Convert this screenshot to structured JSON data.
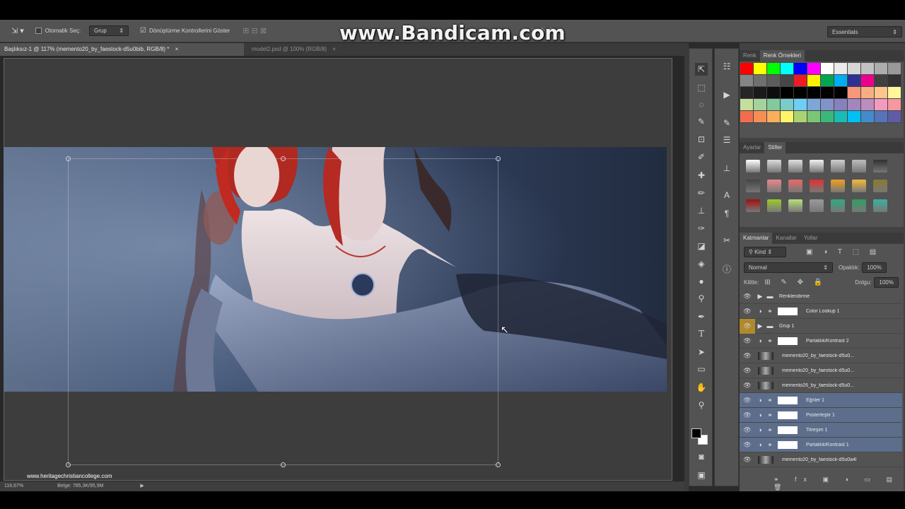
{
  "watermark": "www.Bandicam.com",
  "options_bar": {
    "auto_select_label": "Otomatik Seç:",
    "auto_select_value": "Grup",
    "transform_controls_label": "Dönüştürme Kontrollerini Göster",
    "workspace": "Essentials"
  },
  "document_tabs": [
    {
      "label": "Başlıksız-1 @ 117% (memento20_by_faestock-d5u0bib, RGB/8) *",
      "close": "×"
    },
    {
      "label": "model2.psd @ 100% (RGB/8)",
      "close": "×"
    }
  ],
  "status_bar": {
    "zoom": "116,67%",
    "doc": "Belge: 785,3K/95,9M"
  },
  "site_watermark": "www.heritagechristiancollege.com",
  "color_panel": {
    "tabs": [
      "Renk",
      "Renk Örnekleri"
    ],
    "active": "Renk Örnekleri",
    "row1": [
      "#ff0000",
      "#ffff00",
      "#00ff00",
      "#00ffff",
      "#0000ff",
      "#ff00ff",
      "#ffffff",
      "#ebebeb",
      "#d6d6d6",
      "#c2c2c2",
      "#adadad",
      "#999999"
    ],
    "row2": [
      "#858585",
      "#707070",
      "#5c5c5c",
      "#474747",
      "#ed1c24",
      "#fff200",
      "#00a651",
      "#00aeef",
      "#2e3192",
      "#ec008c",
      "#404040",
      "#333333"
    ],
    "row3": [
      "#262626",
      "#1a1a1a",
      "#0d0d0d",
      "#000000",
      "#000000",
      "#000000",
      "#000000",
      "#000000",
      "#f7977a",
      "#fbad82",
      "#fdc68c",
      "#fff799"
    ],
    "row4": [
      "#c4df9b",
      "#a3d39c",
      "#82ca9c",
      "#7accc8",
      "#6dcff6",
      "#7da7d9",
      "#8393ca",
      "#8781bd",
      "#a187be",
      "#bc8dbf",
      "#f49ac1",
      "#f6989d"
    ],
    "row5": [
      "#f26c4f",
      "#f68e56",
      "#fbaf5d",
      "#fff568",
      "#acd372",
      "#7cc576",
      "#3bb878",
      "#1abbb4",
      "#00bff3",
      "#438ccb",
      "#5574b9",
      "#605ca8"
    ]
  },
  "styles_panel": {
    "tabs": [
      "Ayarlar",
      "Stiller"
    ],
    "active": "Stiller",
    "row1": [
      "#ffffff",
      "#dcdcdc",
      "#e0e0e0",
      "#f2f2f2",
      "#cfcfcf",
      "#bdbdbd",
      "#303030"
    ],
    "row2": [
      "#444444",
      "#e9888b",
      "#e86a6a",
      "#e03030",
      "#f0a020",
      "#f5b83a",
      "#8a7a2e"
    ],
    "row3": [
      "#a01010",
      "#9bcc2a",
      "#b8e07a",
      "#9a9a9a",
      "#2faa80",
      "#2ea060",
      "#3ab0a0"
    ]
  },
  "layers_panel": {
    "tabs": [
      "Katmanlar",
      "Kanallar",
      "Yollar"
    ],
    "active": "Katmanlar",
    "filter": "Kind",
    "blend_mode": "Normal",
    "opacity_label": "Opaklık:",
    "opacity_value": "100%",
    "lock_label": "Kilitle:",
    "fill_label": "Dolgu:",
    "fill_value": "100%",
    "layers": [
      {
        "name": "Renklendirme",
        "type": "group",
        "selected": false
      },
      {
        "name": "Color Lookup 1",
        "type": "adjustment",
        "selected": false
      },
      {
        "name": "Grup 1",
        "type": "group",
        "selected": false,
        "eye_highlight": true
      },
      {
        "name": "Parlaklık/Kontrast 2",
        "type": "adjustment",
        "selected": false
      },
      {
        "name": "memento20_by_faestock-d5u0...",
        "type": "image",
        "selected": false
      },
      {
        "name": "memento20_by_faestock-d5u0...",
        "type": "image",
        "selected": false
      },
      {
        "name": "memento26_by_faestock-d5u0...",
        "type": "image",
        "selected": false
      },
      {
        "name": "Eğriler 1",
        "type": "adjustment",
        "selected": true
      },
      {
        "name": "Posterleştir 1",
        "type": "adjustment",
        "selected": true
      },
      {
        "name": "Titreşim 1",
        "type": "adjustment",
        "selected": true
      },
      {
        "name": "Parlaklık/Kontrast 1",
        "type": "adjustment",
        "selected": true
      },
      {
        "name": "memento20_by_faestock-d5u0a4l",
        "type": "image",
        "selected": false
      }
    ]
  }
}
